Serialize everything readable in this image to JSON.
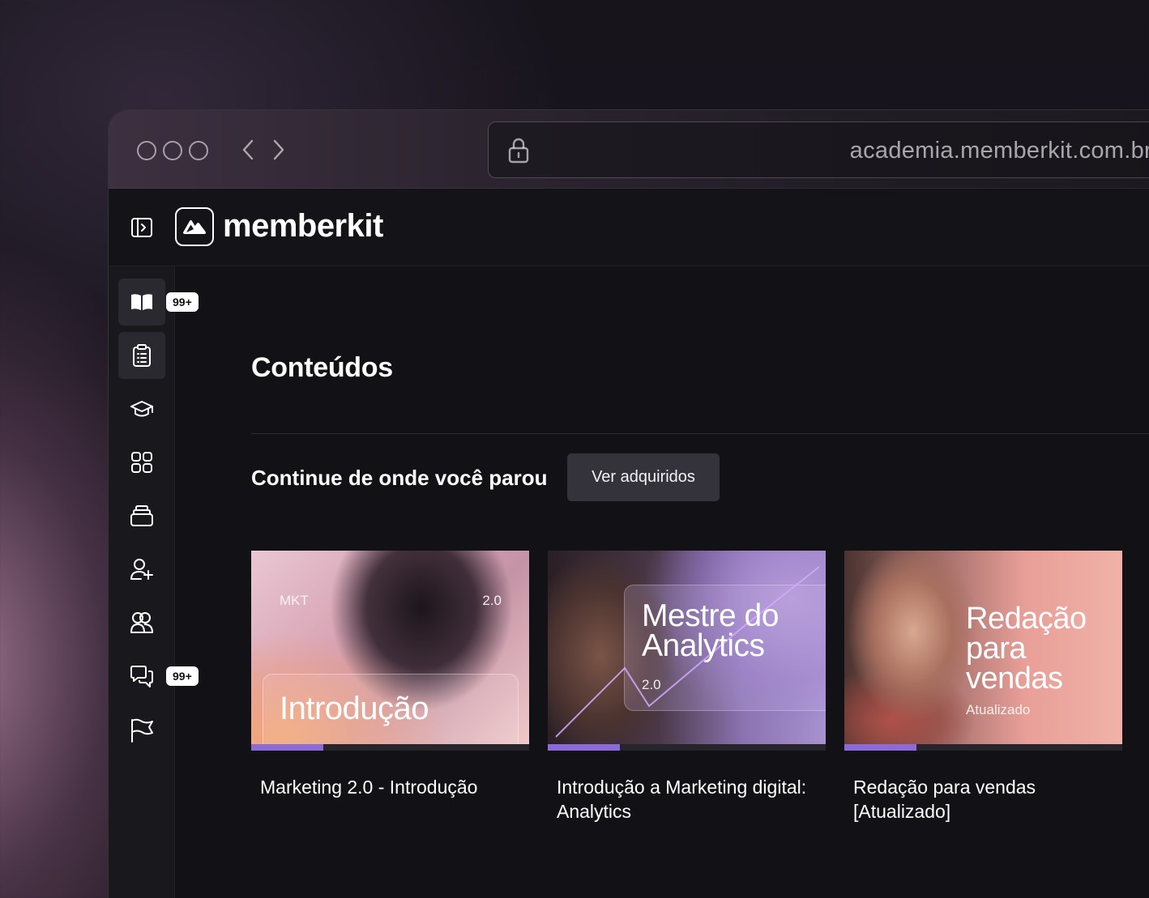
{
  "browser": {
    "url": "academia.memberkit.com.br"
  },
  "app": {
    "brand": "memberkit"
  },
  "sidebar": {
    "items": [
      {
        "name": "contents",
        "icon": "book-open-icon",
        "badge": "99+",
        "active": true
      },
      {
        "name": "tasks",
        "icon": "clipboard-list-icon",
        "badge": "",
        "active": true
      },
      {
        "name": "courses",
        "icon": "graduation-cap-icon",
        "badge": "",
        "active": false
      },
      {
        "name": "apps",
        "icon": "grid-icon",
        "badge": "",
        "active": false
      },
      {
        "name": "products",
        "icon": "stack-icon",
        "badge": "",
        "active": false
      },
      {
        "name": "add-member",
        "icon": "user-plus-icon",
        "badge": "",
        "active": false
      },
      {
        "name": "community",
        "icon": "users-icon",
        "badge": "",
        "active": false
      },
      {
        "name": "comments",
        "icon": "chat-bubbles-icon",
        "badge": "99+",
        "active": false
      },
      {
        "name": "reports",
        "icon": "flag-icon",
        "badge": "",
        "active": false
      }
    ]
  },
  "main": {
    "title": "Conteúdos",
    "section_title": "Continue de onde você parou",
    "ver_button": "Ver adquiridos",
    "cards": [
      {
        "title": "Marketing 2.0 - Introdução",
        "overlay_tag": "MKT",
        "overlay_version": "2.0",
        "overlay_title": "Introdução",
        "progress": 0.26
      },
      {
        "title": "Introdução a Marketing digital: Analytics",
        "overlay_title": "Mestre do Analytics",
        "overlay_version": "2.0",
        "progress": 0.26
      },
      {
        "title": "Redação para vendas [Atualizado]",
        "overlay_title": "Redação para vendas",
        "overlay_sub": "Atualizado",
        "progress": 0.26
      }
    ]
  },
  "colors": {
    "accent": "#8c6ad8",
    "badge_bg": "#ffffff",
    "button_bg": "#34333b"
  }
}
